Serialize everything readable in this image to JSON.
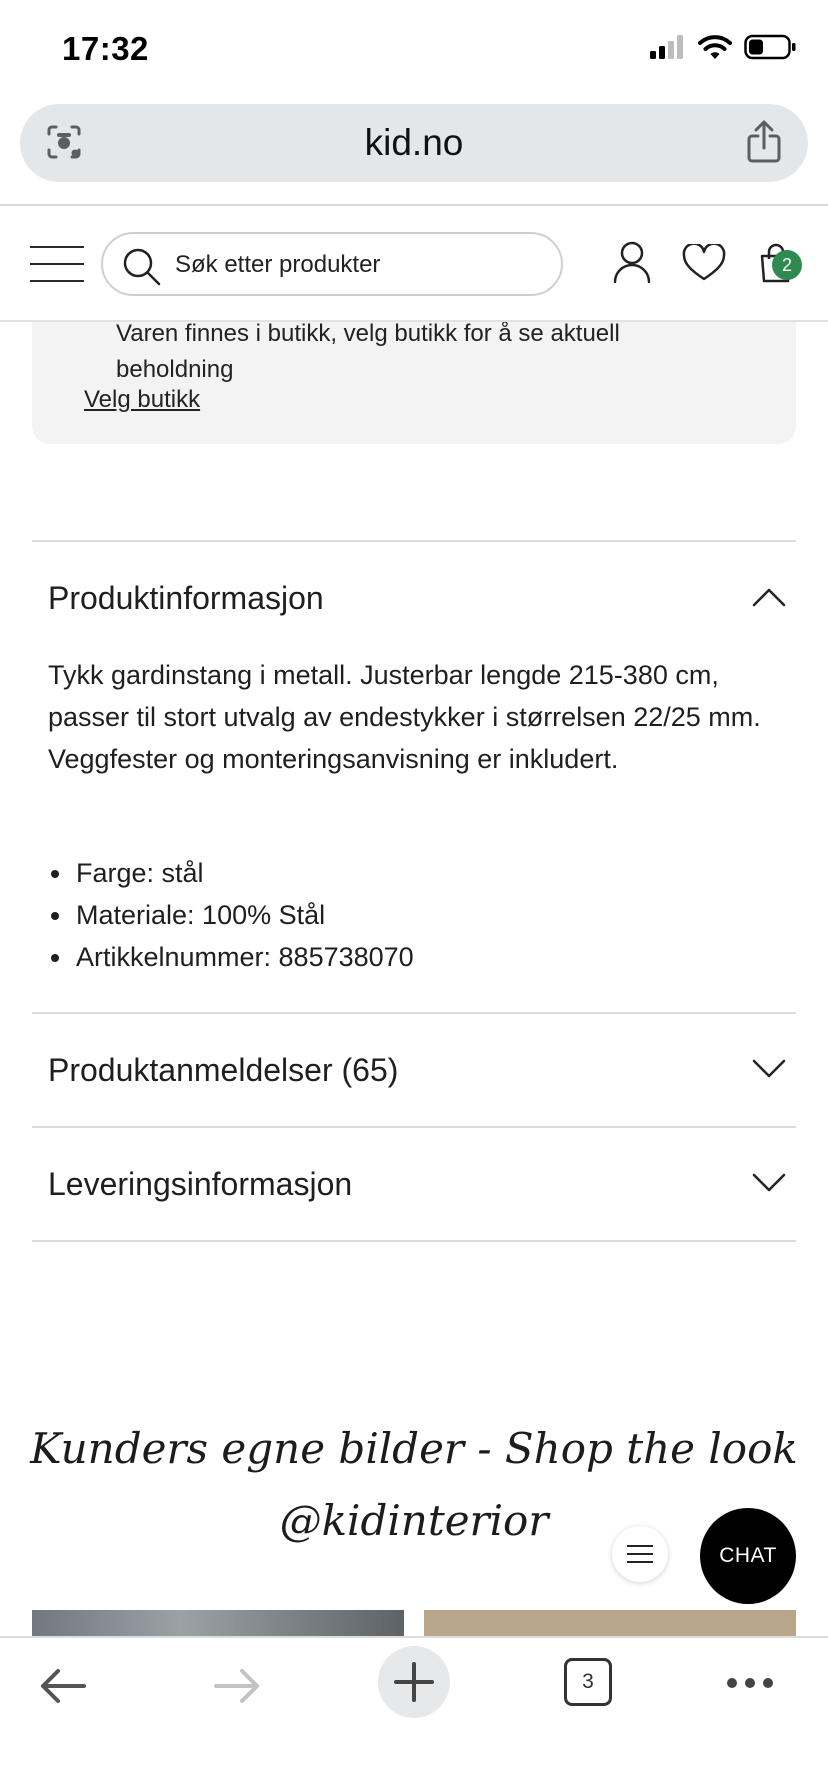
{
  "status_bar": {
    "time": "17:32"
  },
  "browser": {
    "url": "kid.no",
    "tab_count": "3"
  },
  "header": {
    "search_placeholder": "Søk etter produkter",
    "cart_count": "2"
  },
  "store_info": {
    "text": "Varen finnes i butikk, velg butikk for å se aktuell beholdning",
    "link": "Velg butikk"
  },
  "product_info": {
    "title": "Produktinformasjon",
    "description": "Tykk gardinstang i metall. Justerbar lengde 215-380 cm, passer til stort utvalg av endestykker i størrelsen 22/25 mm. Veggfester og monteringsanvisning er inkludert.",
    "specs": [
      "Farge: stål",
      "Materiale: 100% Stål",
      "Artikkelnummer: 885738070"
    ]
  },
  "reviews": {
    "title": "Produktanmeldelser (65)"
  },
  "delivery": {
    "title": "Leveringsinformasjon"
  },
  "shop_the_look": {
    "line1": "Kunders egne bilder - Shop the look",
    "line2": "@kidinterior"
  },
  "chat": {
    "label": "CHAT"
  },
  "colors": {
    "accent_badge": "#2f8a52",
    "chat_bg": "#000000",
    "url_bar_bg": "#e4e7ea",
    "store_box_bg": "#f3f3f3"
  }
}
